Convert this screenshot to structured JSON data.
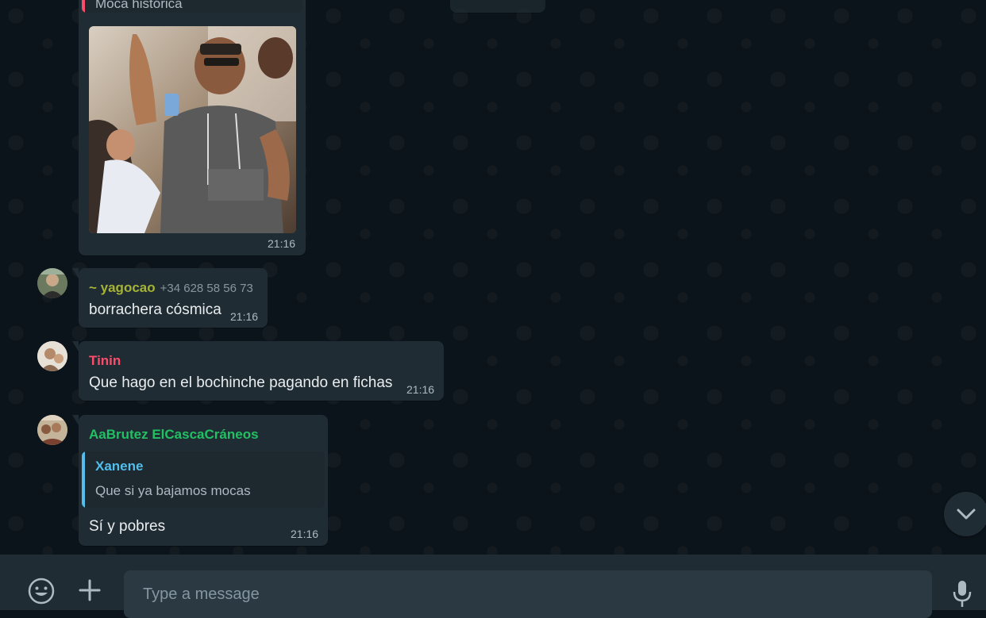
{
  "messages": [
    {
      "quote_text": "Moca histórica",
      "time": "21:16"
    },
    {
      "sender": "~ yagocao",
      "phone": "+34 628 58 56 73",
      "text": "borrachera cósmica",
      "time": "21:16"
    },
    {
      "sender": "Tinin",
      "text": "Que hago en el bochinche pagando en fichas",
      "time": "21:16"
    },
    {
      "sender": "AaBrutez ElCascaCráneos",
      "quote_author": "Xanene",
      "quote_text": "Que si ya bajamos mocas",
      "text": "Sí y pobres",
      "time": "21:16"
    }
  ],
  "composer": {
    "placeholder": "Type a message"
  },
  "colors": {
    "chat_background": "#0b141a",
    "bubble": "#202c33",
    "sender_yagocao": "#a5b337",
    "sender_tinin": "#fc4c6b",
    "sender_aabrutez": "#21c063",
    "quote_author_xanene": "#53bdeb",
    "quote_bar_red": "#fc4c6b",
    "quote_bar_blue": "#53bdeb"
  },
  "icons": [
    "emoji-icon",
    "attach-plus-icon",
    "microphone-icon",
    "chevron-down-icon"
  ]
}
